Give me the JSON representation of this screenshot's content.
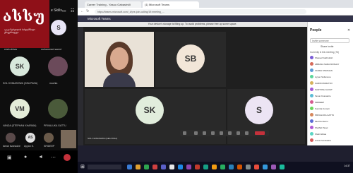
{
  "logo": {
    "letters": "ასსუ",
    "subtitle": "აკაკი წერეთლის სახელმწიფო უნივერსიტეტი"
  },
  "phone": {
    "title": "e Skills...",
    "participants": [
      {
        "initials": "S",
        "name": ""
      },
      {
        "initials": "",
        "name": "shah abbas"
      },
      {
        "initials": "",
        "name": "mohammed saeed"
      },
      {
        "initials": "SK",
        "name": "SOL KHINASHWA (GEA PASA)"
      },
      {
        "initials": "",
        "name": "muchia"
      },
      {
        "initials": "VM",
        "name": "VANDA (STEPHAN KHARAM)"
      },
      {
        "initials": "",
        "name": "PRIVALUKA GATTU"
      }
    ],
    "bottom": [
      {
        "initials": "",
        "name": "tamar kvanadze"
      },
      {
        "initials": "AS",
        "name": "Ayyan S."
      },
      {
        "initials": "",
        "name": "SRIDEEP"
      }
    ]
  },
  "browser": {
    "tabs": [
      "Career Training - Yasuo Gabashvili",
      "(1) Microsoft Teams"
    ],
    "url": "https://teams.microsoft.com/_#/pre-join-calling/19:meeting_..."
  },
  "teams": {
    "app_title": "Microsoft Teams",
    "banner": "Your device's storage is filling up. To avoid problems, please free up some space."
  },
  "meeting": {
    "tiles": [
      {
        "initials": "",
        "name": ""
      },
      {
        "initials": "SB",
        "name": ""
      },
      {
        "initials": "SK",
        "name": "SOL KHINASHWA (GEA PASA)"
      },
      {
        "initials": "S",
        "name": ""
      }
    ]
  },
  "people": {
    "header": "People",
    "invite_placeholder": "Invite someone",
    "share": "Share invite",
    "section": "Currently in this meeting (76)",
    "list": [
      {
        "name": "Shareef Fakhrulloh",
        "color": "#7a5bd6"
      },
      {
        "name": "ABRANA SARA MOSLEY",
        "color": "#d66b5b"
      },
      {
        "name": "VANDA STEPHAN",
        "color": "#5b9bd6"
      },
      {
        "name": "Ayyan Sultanova",
        "color": "#5bd69a"
      },
      {
        "name": "KARIM MURATOV",
        "color": "#d6b25b"
      },
      {
        "name": "SANTOSH GAYAT",
        "color": "#a35bd6"
      },
      {
        "name": "Tamar Kvanadze",
        "color": "#5bbcd6"
      },
      {
        "name": "SRIDEEP",
        "color": "#d65b8f"
      },
      {
        "name": "Sumitra Kumari",
        "color": "#6bd65b"
      },
      {
        "name": "PRIVALUKA GATTU",
        "color": "#d6875b"
      },
      {
        "name": "Muchia Alemu",
        "color": "#5b6bd6"
      },
      {
        "name": "Sheffali Pavel",
        "color": "#b05bd6"
      },
      {
        "name": "Shah Abbas",
        "color": "#5bd6c4"
      },
      {
        "name": "Anna Purnikasha",
        "color": "#d65b5b"
      }
    ]
  },
  "clock": {
    "time": "14:37",
    "date": "7/29/2023"
  }
}
